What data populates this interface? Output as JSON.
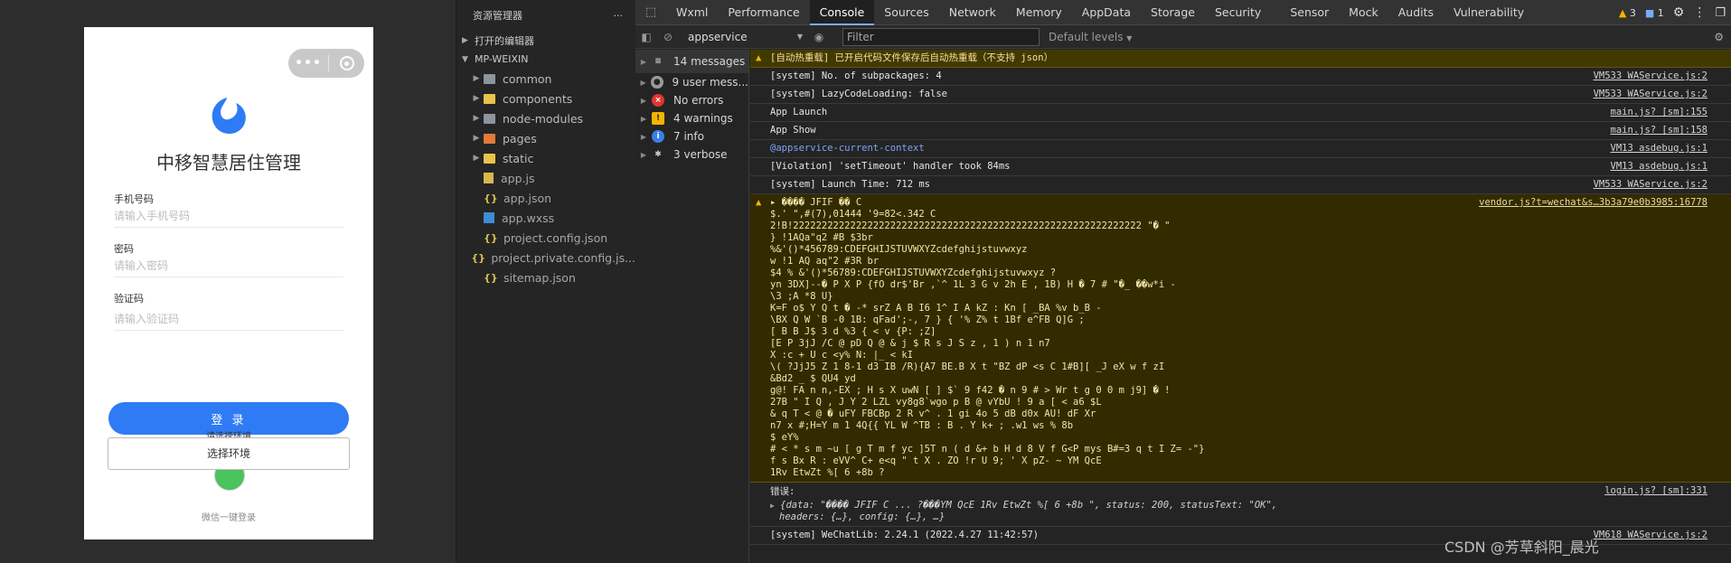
{
  "simulator": {
    "capsule_dots": "•••",
    "app_title": "中移智慧居住管理",
    "phone_label": "手机号码",
    "phone_placeholder": "请输入手机号码",
    "password_label": "密码",
    "password_placeholder": "请输入密码",
    "code_label": "验证码",
    "code_placeholder": "请输入验证码",
    "login_button": "登 录",
    "env_tip": "请选择环境",
    "env_popover": "选择环境",
    "wechat_login": "微信一键登录"
  },
  "explorer": {
    "title": "资源管理器",
    "more": "···",
    "open_editors": "打开的编辑器",
    "project": "MP-WEIXIN",
    "items": [
      {
        "label": "common",
        "icon": "folder-grey",
        "kind": "folder"
      },
      {
        "label": "components",
        "icon": "folder-yellow",
        "kind": "folder"
      },
      {
        "label": "node-modules",
        "icon": "folder-grey",
        "kind": "folder"
      },
      {
        "label": "pages",
        "icon": "folder-orange",
        "kind": "folder"
      },
      {
        "label": "static",
        "icon": "folder-yellow",
        "kind": "folder"
      },
      {
        "label": "app.js",
        "icon": "js",
        "kind": "file"
      },
      {
        "label": "app.json",
        "icon": "json",
        "kind": "file"
      },
      {
        "label": "app.wxss",
        "icon": "wxss",
        "kind": "file"
      },
      {
        "label": "project.config.json",
        "icon": "json",
        "kind": "file"
      },
      {
        "label": "project.private.config.js...",
        "icon": "json",
        "kind": "file"
      },
      {
        "label": "sitemap.json",
        "icon": "json",
        "kind": "file"
      }
    ]
  },
  "devtools": {
    "tabs": [
      "Wxml",
      "Performance",
      "Console",
      "Sources",
      "Network",
      "Memory",
      "AppData",
      "Storage",
      "Security",
      "Sensor",
      "Mock",
      "Audits",
      "Vulnerability"
    ],
    "active_tab": "Console",
    "warn_count": "3",
    "info_count": "1",
    "context": "appservice",
    "filter_placeholder": "Filter",
    "levels": "Default levels",
    "sidebar": [
      {
        "label": "14 messages",
        "icon": "list"
      },
      {
        "label": "9 user mess...",
        "icon": "user"
      },
      {
        "label": "No errors",
        "icon": "error"
      },
      {
        "label": "4 warnings",
        "icon": "warning"
      },
      {
        "label": "7 info",
        "icon": "info"
      },
      {
        "label": "3 verbose",
        "icon": "verbose"
      }
    ],
    "console": {
      "hot_reload_warning": "[自动热重载] 已开启代码文件保存后自动热重载（不支持 json）",
      "logs": [
        {
          "text": "[system] No. of subpackages: 4",
          "src": "VM533 WAService.js:2"
        },
        {
          "text": "[system] LazyCodeLoading: false",
          "src": "VM533 WAService.js:2"
        },
        {
          "text": "App Launch",
          "src": "main.js? [sm]:155"
        },
        {
          "text": "App Show",
          "src": "main.js? [sm]:158"
        },
        {
          "text": "@appservice-current-context",
          "src": "VM13 asdebug.js:1"
        },
        {
          "text": "[Violation] 'setTimeout' handler took 84ms",
          "src": "VM13 asdebug.js:1"
        },
        {
          "text": "[system] Launch Time: 712 ms",
          "src": "VM533 WAService.js:2"
        }
      ],
      "garbled_src": "vendor.js?t=wechat&s…3b3a79e0b3985:16778",
      "garbled_lines": [
        "▸ ����  JFIF     ��  C                    ",
        "                  $.' \",#(7),01444 '9=82<.342  C ",
        "2!B!2222222222222222222222222222222222222222222222222222222222222   \"�   \"            ",
        "                      }      !1AQa\"q2   #B     $3br ",
        "   %&'()*456789:CDEFGHIJSTUVWXYZcdefghijstuvwxyz                                                                                       ",
        "                    w      !1 AQ aq\"2      #3R br ",
        "$4 %    &'()*56789:CDEFGHIJSTUVWXYZcdefghijstuvwxyz                                                                                                ?",
        "yn    3DX]--�   P X  P    {fO dr$'Br        ,`^    1L    3 G  v 2h E  , 1B)      H   � 7 # \"�_ ��w*i -",
        "\\3  ;A       *8   U}",
        "  K=F  o$     Y   Q  t �  -*  srZ A B   I6 1^  I   A   kZ  : Kn [ _BA           %v b_B  -",
        "   \\BX Q W `B  -0  1B: qFad';-, 7 }  {   '%   Z% t 1Bf  e^FB   Q]G ;",
        "[  B  B J$    3 d   %3   {   < v        {P: ;Z]",
        "[E    P   3jJ     /C   @  pD                Q   @ & j  $   R s   J   S  z  ,  1   )      n     1     n7 ",
        "X   :c   +  U     c <y% N:      |_ <  kI",
        "\\(       ?JjJ5      Z    1    8-1  d3 IB /R){A7  BE.B     X t  \"BZ  dP   <s  C    1#B][ _J  eX     w  f   zI",
        "           &Bd2 _ $   QU4   yd",
        "g@!   FA    n n,-EX    ; H s  X  uwN      [ ]   $` 9 f42 �  n 9  #  >      Wr   t  g   0  0  m j9]  �     !",
        "27B \"  I Q , J Y 2 LZL  vy8g8`wgo                 p B @ vYbU  !            9  a   [  <  a6 $L",
        "&  q      T  <   @   � uFY FBCBp            2     R v^ .  1        gi 4o  5    dB d0x   AU!        dF     Xr ",
        "   n7 x  #;H=Y m    1    4Q{{ YL  W   ^TB         : B .  Y k+ ;     .w1      ws %      8b         ",
        "       $ eY%",
        "   #  <  * s     m     ~u  [ g T   m   f  yc ]5T n   (  d &+ b H  d 8   V   f  G<P mys  B#=3 q  t I Z=     -\"}",
        "f s  Bx    R   : eVV^  C+ e<q \"  t   X    . ZO     !r  U    9;  ' X  pZ-    ~     YM     QcE ",
        " 1Rv EtwZt   %[ 6 +8b        ?  "
      ],
      "error_label": "错误:",
      "error_src": "login.js? [sm]:331",
      "error_obj_line1": "{data: \"����  JFIF          C                        ... ?���YM   QcE  1Rv EtwZt  %[ 6 +8b       \", status: 200, statusText: \"OK\",",
      "error_obj_line2": "headers: {…}, config: {…}, …}",
      "last_log": "[system] WeChatLib: 2.24.1 (2022.4.27 11:42:57)",
      "last_src": "VM618 WAService.js:2"
    }
  },
  "watermark": "CSDN @芳草斜阳_晨光"
}
